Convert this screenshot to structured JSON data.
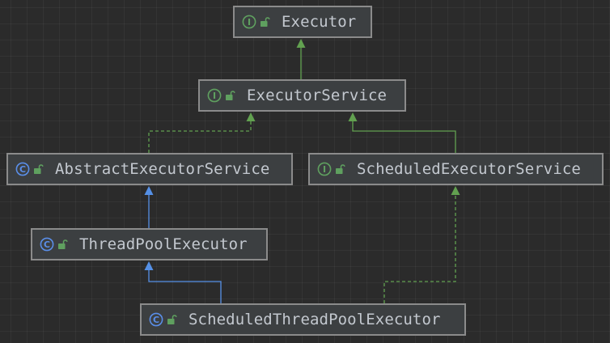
{
  "diagram": {
    "nodes": {
      "executor": {
        "kind": "interface",
        "label": "Executor"
      },
      "executor_service": {
        "kind": "interface",
        "label": "ExecutorService"
      },
      "abstract_executor_service": {
        "kind": "class",
        "label": "AbstractExecutorService"
      },
      "scheduled_executor_service": {
        "kind": "interface",
        "label": "ScheduledExecutorService"
      },
      "thread_pool_executor": {
        "kind": "class",
        "label": "ThreadPoolExecutor"
      },
      "scheduled_thread_pool_executor": {
        "kind": "class",
        "label": "ScheduledThreadPoolExecutor"
      }
    },
    "edges": [
      {
        "from": "executor_service",
        "to": "executor",
        "type": "extends"
      },
      {
        "from": "abstract_executor_service",
        "to": "executor_service",
        "type": "implements"
      },
      {
        "from": "scheduled_executor_service",
        "to": "executor_service",
        "type": "extends"
      },
      {
        "from": "thread_pool_executor",
        "to": "abstract_executor_service",
        "type": "extends"
      },
      {
        "from": "scheduled_thread_pool_executor",
        "to": "thread_pool_executor",
        "type": "extends"
      },
      {
        "from": "scheduled_thread_pool_executor",
        "to": "scheduled_executor_service",
        "type": "implements"
      }
    ]
  },
  "icons": {
    "interface": "interface-icon",
    "class": "class-icon",
    "visibility": "unlocked-padlock-icon"
  },
  "colors": {
    "background": "#2b2b2b",
    "node_fill": "#3c3f41",
    "node_border": "#8b8b8b",
    "node_text": "#c3c8cf",
    "interface_green": "#5fa05f",
    "class_blue": "#5a8ee8",
    "interface_edge": "#62a150",
    "class_edge": "#5590e6",
    "lock_green": "#5fa05f"
  }
}
